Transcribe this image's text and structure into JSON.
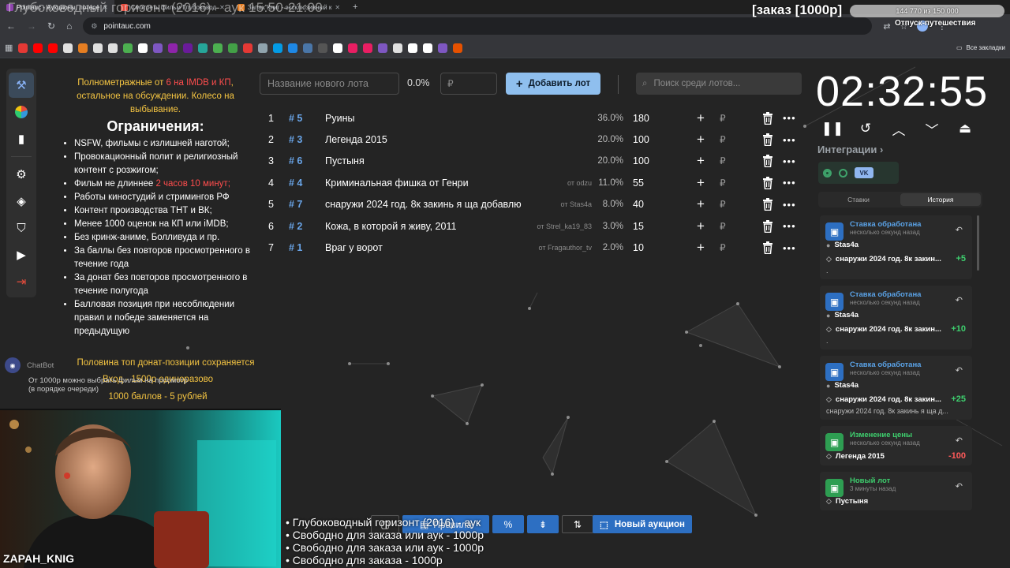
{
  "browser": {
    "tabs": [
      {
        "label": "Pointauc - Аукционы, лотере",
        "icon_color": "#8e44ad",
        "active": true
      },
      {
        "label": "Смотреть фильм Глубоковод",
        "icon_color": "#e74c3c",
        "active": false
      },
      {
        "label": "Запах Книг - эксклюзивный к",
        "icon_color": "#e67e22",
        "active": false
      }
    ],
    "url": "pointauc.com",
    "all_bookmarks": "Все закладки"
  },
  "overlay": {
    "title": "Глубоководный горизонт (2016) - аук 15:50-21:00",
    "order": "[заказ [1000р]",
    "progress_text": "144 770 из 150 000",
    "progress_fraction": 0.965,
    "trip": "Отпуск-путешествия",
    "streamer": "ZAPAH_KNIG",
    "ticker": [
      "• Глубоководный горизонт (2016) - аук",
      "• Свободно для заказа или аук - 1000р",
      "• Свободно для заказа или аук - 1000р",
      "• Свободно для заказа - 1000р"
    ]
  },
  "rules": {
    "intro_a": "Полнометражные от ",
    "intro_red": "6 на IMDB и КП",
    "intro_b": ", остальное на обсуждении. Колесо на выбывание.",
    "heading": "Ограничения:",
    "items": [
      "NSFW, фильмы с излишней наготой;",
      "Провокационный полит и религиозный контент с розжигом;",
      "Работы киностудий и стримингов РФ",
      "Контент производства ТНТ и ВК;",
      "Менее 1000 оценок на КП или iMDB;",
      "Без кринж-аниме, Болливуда и пр.",
      "За баллы без повторов просмотренного в течение года",
      "За донат без повторов просмотренного в течение полугода",
      "Балловая позиция при несоблюдении правил и победе заменяется на предыдущую"
    ],
    "length_a": "Фильм не длиннее ",
    "length_red": "2 часов 10 минут;",
    "half_top": "Половина топ донат-позиции сохраняется",
    "entry": "Вход - 1500р единоразово",
    "points": "1000 баллов - 5 рублей"
  },
  "chatbot": {
    "name": "ChatBot",
    "line1": "От 1000р можно выбрать фильм на просмотр",
    "line2": "(в порядке очереди)"
  },
  "auction": {
    "name_placeholder": "Название нового лота",
    "percent": "0.0%",
    "amount_placeholder": "₽",
    "add_label": "Добавить лот",
    "search_placeholder": "Поиск среди лотов...",
    "lots": [
      {
        "num": "1",
        "id": "# 5",
        "name": "Руины",
        "from": "",
        "pct": "36.0%",
        "sum": "180"
      },
      {
        "num": "2",
        "id": "# 3",
        "name": "Легенда 2015",
        "from": "",
        "pct": "20.0%",
        "sum": "100"
      },
      {
        "num": "3",
        "id": "# 6",
        "name": "Пустыня",
        "from": "",
        "pct": "20.0%",
        "sum": "100"
      },
      {
        "num": "4",
        "id": "# 4",
        "name": "Криминальная фишка от Генри",
        "from": "от odzu",
        "pct": "11.0%",
        "sum": "55"
      },
      {
        "num": "5",
        "id": "# 7",
        "name": "снаружи 2024 год. 8к закинь я ща добавлю",
        "from": "от Stas4a",
        "pct": "8.0%",
        "sum": "40"
      },
      {
        "num": "6",
        "id": "# 2",
        "name": "Кожа, в которой я живу, 2011",
        "from": "от Strel_ka19_83",
        "pct": "3.0%",
        "sum": "15"
      },
      {
        "num": "7",
        "id": "# 1",
        "name": "Враг у ворот",
        "from": "от Fragauthor_tv",
        "pct": "2.0%",
        "sum": "10"
      }
    ],
    "currency": "₽",
    "new_auction": "Новый аукцион",
    "bottom_rules": "Правила"
  },
  "timer": {
    "value": "02:32:55"
  },
  "integrations": {
    "title": "Интеграции",
    "vk_label": "VK"
  },
  "history": {
    "tabs": [
      "Ставки",
      "История"
    ],
    "cards": [
      {
        "title": "Ставка обработана",
        "time": "несколько секунд назад",
        "user": "Stas4a",
        "lot": "снаружи 2024 год. 8к закин...",
        "amount": "+5",
        "note": ".",
        "title_color": "#5aa3e8",
        "icon_bg": "#2d6fc2",
        "amount_color": "#3ecf6e"
      },
      {
        "title": "Ставка обработана",
        "time": "несколько секунд назад",
        "user": "Stas4a",
        "lot": "снаружи 2024 год. 8к закин...",
        "amount": "+10",
        "note": ".",
        "title_color": "#5aa3e8",
        "icon_bg": "#2d6fc2",
        "amount_color": "#3ecf6e"
      },
      {
        "title": "Ставка обработана",
        "time": "несколько секунд назад",
        "user": "Stas4a",
        "lot": "снаружи 2024 год. 8к закин...",
        "amount": "+25",
        "note": "снаружи 2024 год. 8к закинь я ща д...",
        "title_color": "#5aa3e8",
        "icon_bg": "#2d6fc2",
        "amount_color": "#3ecf6e"
      },
      {
        "title": "Изменение цены",
        "time": "несколько секунд назад",
        "user": "",
        "lot": "Легенда 2015",
        "amount": "-100",
        "note": "",
        "title_color": "#3ecf6e",
        "icon_bg": "#2e9e52",
        "amount_color": "#ff5a5a"
      },
      {
        "title": "Новый лот",
        "time": "3 минуты назад",
        "user": "",
        "lot": "Пустыня",
        "amount": "",
        "note": "",
        "title_color": "#3ecf6e",
        "icon_bg": "#2e9e52",
        "amount_color": "#3ecf6e"
      }
    ]
  }
}
